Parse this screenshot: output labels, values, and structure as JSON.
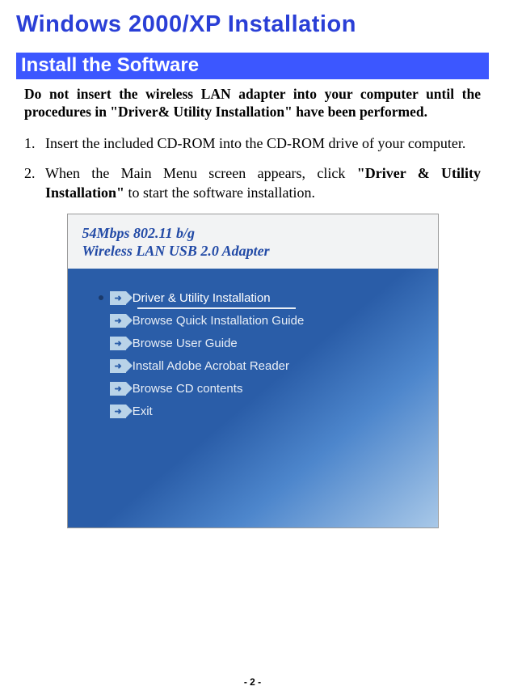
{
  "title": "Windows 2000/XP Installation",
  "section_header": "Install the Software",
  "warning": "Do not insert the wireless LAN adapter into your computer until the procedures in \"Driver& Utility Installation\" have been performed.",
  "steps": [
    {
      "num": "1.",
      "text_before": "Insert the included CD-ROM into the CD-ROM drive of your computer.",
      "bold": "",
      "text_after": ""
    },
    {
      "num": "2.",
      "text_before": "When the Main Menu screen appears, click ",
      "bold": "\"Driver & Utility Installation\"",
      "text_after": " to start the software installation."
    }
  ],
  "screenshot": {
    "title_line1": "54Mbps 802.11 b/g",
    "title_line2": "Wireless LAN USB 2.0 Adapter",
    "menu": [
      {
        "label": "Driver & Utility Installation",
        "active": true
      },
      {
        "label": "Browse Quick Installation Guide",
        "active": false
      },
      {
        "label": "Browse User Guide",
        "active": false
      },
      {
        "label": "Install Adobe Acrobat Reader",
        "active": false
      },
      {
        "label": "Browse CD contents",
        "active": false
      },
      {
        "label": "Exit",
        "active": false
      }
    ]
  },
  "footer": "- 2 -"
}
